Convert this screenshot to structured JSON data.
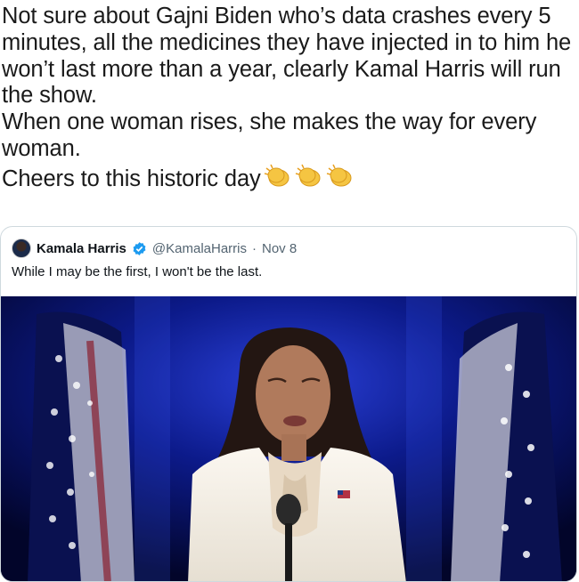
{
  "tweet": {
    "lines": [
      "Not sure about Gajni Biden who’s data crashes every 5 minutes, all the medicines they have injected in to him he won’t last more than a year, clearly Kamal Harris will run the show.",
      "When one woman rises, she makes the way for every woman.",
      "Cheers to this historic day"
    ],
    "emoji": [
      "clapping-hands",
      "clapping-hands",
      "clapping-hands"
    ]
  },
  "quote": {
    "author_name": "Kamala Harris",
    "verified": true,
    "handle": "@KamalaHarris",
    "separator": "·",
    "date": "Nov 8",
    "text": "While I may be the first, I won't be the last."
  },
  "colors": {
    "text": "#0f1419",
    "secondary": "#536471",
    "verified_blue": "#1d9bf0",
    "border": "#cfd9de",
    "stage_blue": "#0a1466"
  }
}
